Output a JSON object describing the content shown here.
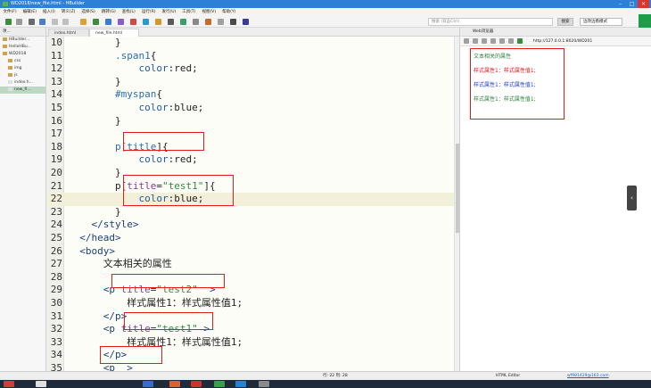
{
  "window": {
    "title": "WD2018/new_file.html - HBuilder"
  },
  "menu": [
    "文件(F)",
    "编辑(E)",
    "插入(I)",
    "转义(Z)",
    "选择(S)",
    "跳转(G)",
    "查找(L)",
    "运行(R)",
    "发行(U)",
    "工具(T)",
    "视图(V)",
    "帮助(Y)"
  ],
  "toolbar": {
    "search_placeholder": "搜索 (双击Ctrl)",
    "search_button": "搜索",
    "mode_label": "边改边看模式"
  },
  "project_panel": {
    "tab_label": "项...",
    "tree": [
      {
        "label": "HBuilder..."
      },
      {
        "label": "HelloHBu..."
      },
      {
        "label": "WD2018"
      },
      {
        "label": "css"
      },
      {
        "label": "img"
      },
      {
        "label": "js"
      },
      {
        "label": "index.h..."
      },
      {
        "label": "new_fi..."
      }
    ]
  },
  "editor": {
    "tabs": [
      {
        "label": "index.html"
      },
      {
        "label": "new_file.html"
      }
    ],
    "lines": [
      {
        "n": "10",
        "code": "        }"
      },
      {
        "n": "11",
        "code": "        .span1{"
      },
      {
        "n": "12",
        "code": "            color:red;"
      },
      {
        "n": "13",
        "code": "        }"
      },
      {
        "n": "14",
        "code": "        #myspan{"
      },
      {
        "n": "15",
        "code": "            color:blue;"
      },
      {
        "n": "16",
        "code": "        }"
      },
      {
        "n": "17",
        "code": ""
      },
      {
        "n": "18",
        "code": "        p[title]{"
      },
      {
        "n": "19",
        "code": "            color:red;"
      },
      {
        "n": "20",
        "code": "        }"
      },
      {
        "n": "21",
        "code": "        p[title=\"test1\"]{"
      },
      {
        "n": "22",
        "code": "            color:blue;"
      },
      {
        "n": "23",
        "code": "        }"
      },
      {
        "n": "24",
        "code": "    </style>"
      },
      {
        "n": "25",
        "code": "  </head>"
      },
      {
        "n": "26",
        "code": "  <body>"
      },
      {
        "n": "27",
        "code": "      文本相关的属性"
      },
      {
        "n": "28",
        "code": ""
      },
      {
        "n": "29",
        "code": "      <p title=\"test2\"  >"
      },
      {
        "n": "30",
        "code": "          样式属性1：样式属性值1;"
      },
      {
        "n": "31",
        "code": "      </p>"
      },
      {
        "n": "32",
        "code": "      <p title=\"test1\" >"
      },
      {
        "n": "33",
        "code": "          样式属性1：样式属性值1;"
      },
      {
        "n": "34",
        "code": "      </p>"
      },
      {
        "n": "35",
        "code": "      <p  >"
      }
    ]
  },
  "preview_panel": {
    "tab_label": "Web浏览器",
    "url": "http://127.0.0.1:8020/WD201",
    "lines": [
      {
        "text": "文本相关的属性",
        "color": "#2f7f3a"
      },
      {
        "text": "样式属性1：样式属性值1;",
        "color": "#d22020"
      },
      {
        "text": "样式属性1：样式属性值1;",
        "color": "#1f3fc6"
      },
      {
        "text": "样式属性1：样式属性值1;",
        "color": "#2f7f3a"
      }
    ]
  },
  "statusbar": {
    "position": "行: 22 列: 28",
    "editor_type": "HTML Editor",
    "user": "wf981429@163.com"
  },
  "colors": {
    "accent": "#2e7fd8",
    "annotation_red": "#e21b1b"
  }
}
